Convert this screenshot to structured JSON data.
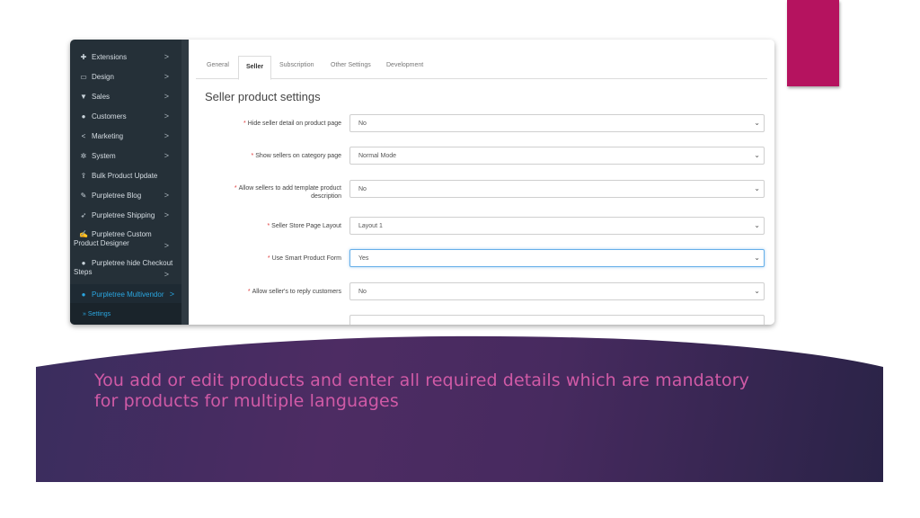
{
  "sidebar": {
    "items": [
      {
        "icon": "puzzle-icon",
        "glyph": "✚",
        "label": "Extensions",
        "chevron": ">"
      },
      {
        "icon": "monitor-icon",
        "glyph": "▭",
        "label": "Design",
        "chevron": ">"
      },
      {
        "icon": "cart-icon",
        "glyph": "▼",
        "label": "Sales",
        "chevron": ">"
      },
      {
        "icon": "user-icon",
        "glyph": "●",
        "label": "Customers",
        "chevron": ">"
      },
      {
        "icon": "share-icon",
        "glyph": "<",
        "label": "Marketing",
        "chevron": ">"
      },
      {
        "icon": "gear-icon",
        "glyph": "✲",
        "label": "System",
        "chevron": ">"
      },
      {
        "icon": "upload-icon",
        "glyph": "⇪",
        "label": "Bulk Product Update",
        "chevron": ""
      },
      {
        "icon": "edit-icon",
        "glyph": "✎",
        "label": "Purpletree Blog",
        "chevron": ">"
      },
      {
        "icon": "rocket-icon",
        "glyph": "➶",
        "label": "Purpletree Shipping",
        "chevron": ">"
      },
      {
        "icon": "brush-icon",
        "glyph": "✍",
        "label_line1": "Purpletree Custom",
        "label_line2": "Product Designer",
        "chevron": ">"
      },
      {
        "icon": "user-icon",
        "glyph": "●",
        "label_line1": "Purpletree hide Checkout",
        "label_line2": "Steps",
        "chevron": ">"
      },
      {
        "icon": "user-icon",
        "glyph": "●",
        "label": "Purpletree Multivendor",
        "chevron": ">"
      }
    ],
    "sub_item": "» Settings"
  },
  "main": {
    "tabs": [
      "General",
      "Seller",
      "Subscription",
      "Other Settings",
      "Development"
    ],
    "section_title": "Seller product settings",
    "fields": [
      {
        "label": "Hide seller detail on product page",
        "value": "No"
      },
      {
        "label": "Show sellers on category page",
        "value": "Normal Mode"
      },
      {
        "label_line1": "Allow sellers to add template product",
        "label_line2": "description",
        "value": "No"
      },
      {
        "label": "Seller Store Page Layout",
        "value": "Layout 1"
      },
      {
        "label": "Use Smart Product Form",
        "value": "Yes"
      },
      {
        "label": "Allow seller's to reply customers",
        "value": "No"
      }
    ],
    "required_mark": "*",
    "caret": "⌄"
  },
  "slide": {
    "text_line1": "You add or edit products and enter all required details which are mandatory",
    "text_line2": "for products for multiple languages"
  },
  "colors": {
    "accent": "#b5135f",
    "sidebar": "#253038",
    "active_link": "#2aa6e0",
    "slide_text": "#d05aa6"
  }
}
